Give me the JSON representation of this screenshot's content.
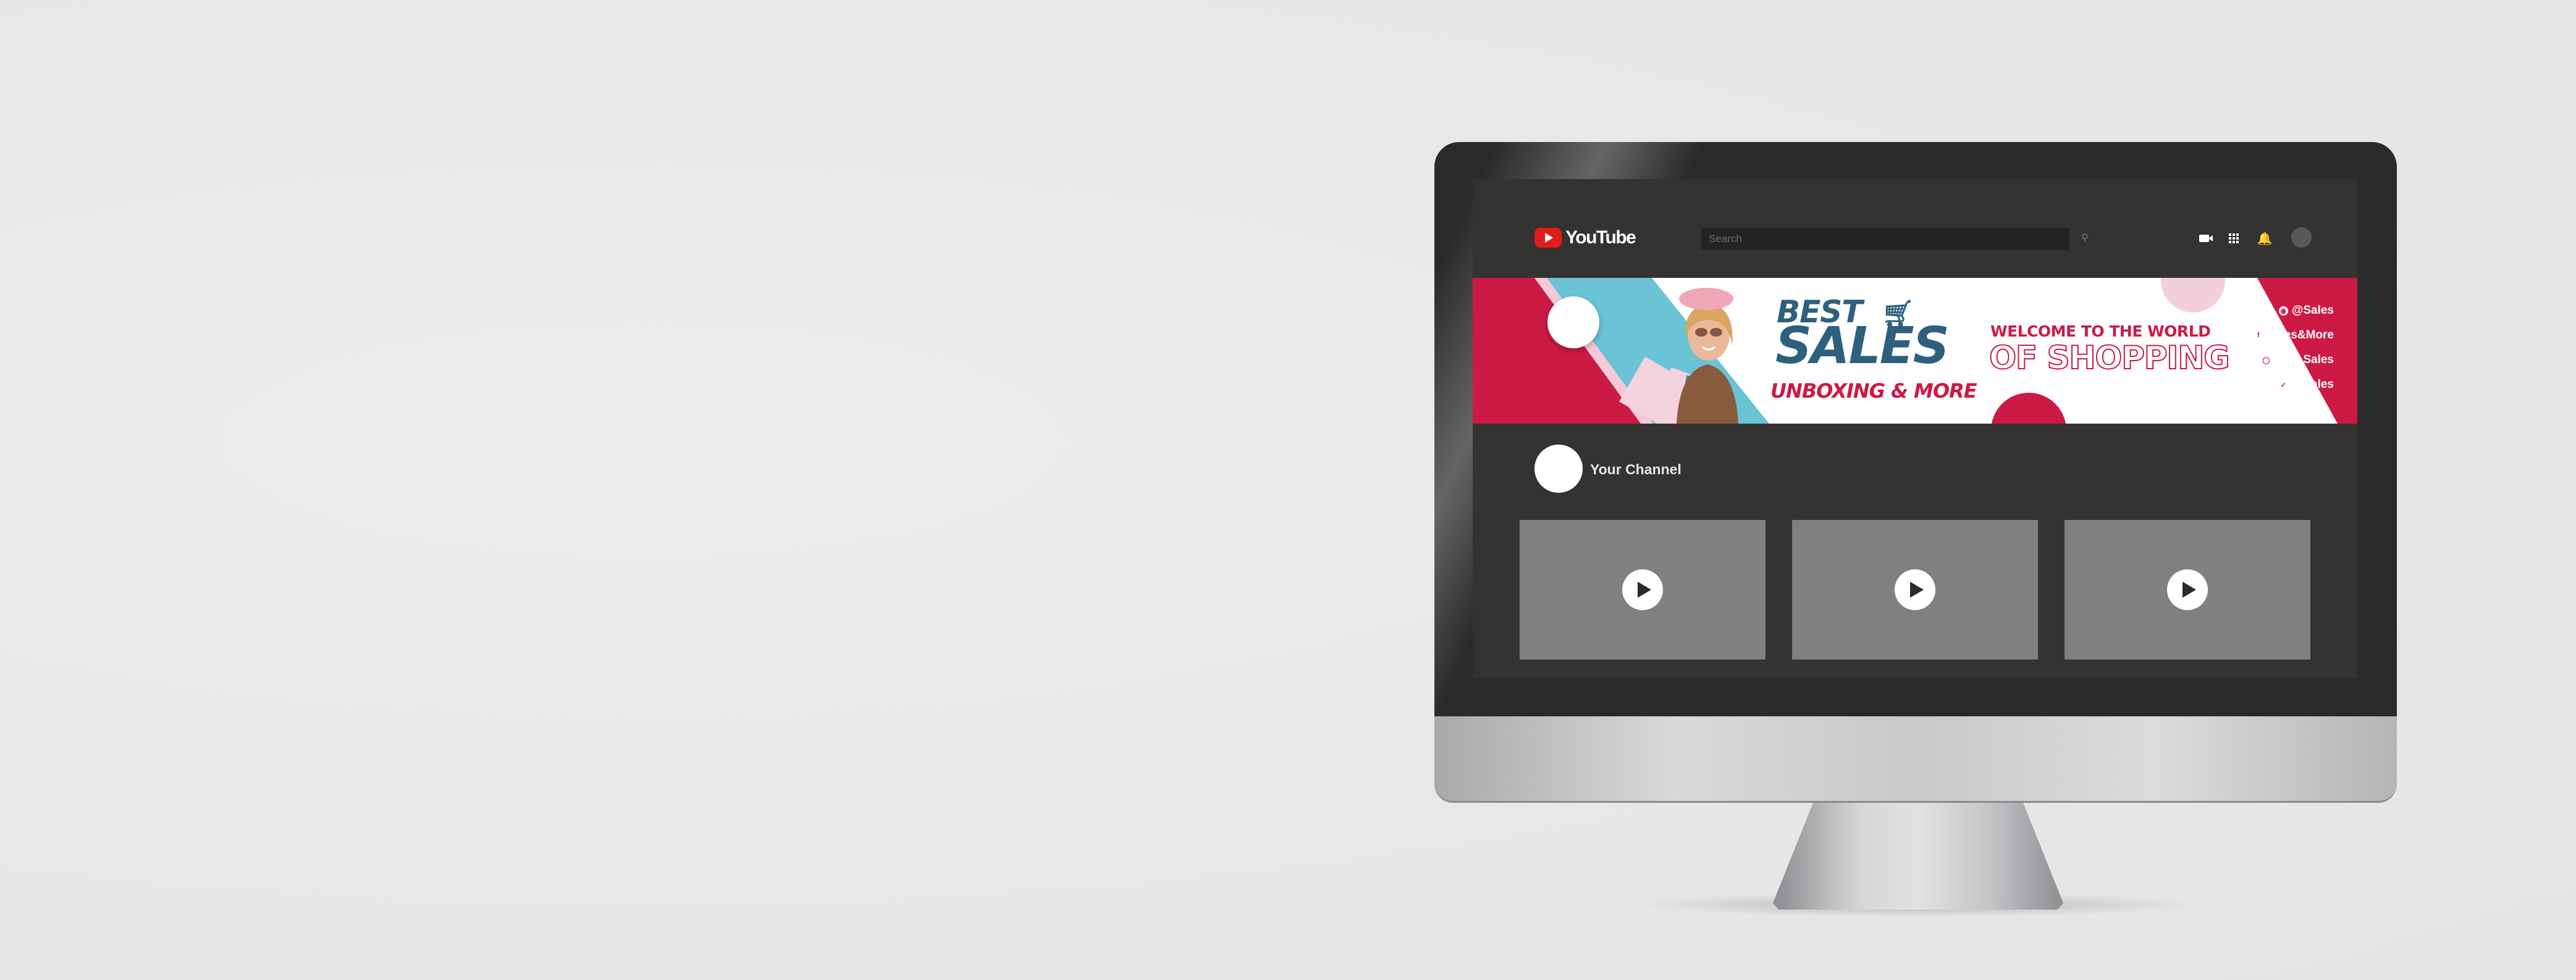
{
  "youtube": {
    "logo_text": "YouTube",
    "search_placeholder": "Search"
  },
  "top_icons": [
    "video-camera-icon",
    "apps-grid-icon",
    "bell-icon",
    "account-avatar"
  ],
  "banner": {
    "best": "BEST",
    "sales": "SALES",
    "unboxing": "UNBOXING & MORE",
    "welcome": "WELCOME TO THE WORLD",
    "shopping": "OF SHOPPING",
    "socials": [
      {
        "icon": "instagram-icon",
        "label": "@Sales"
      },
      {
        "icon": "facebook-icon",
        "label": "Sales&More"
      },
      {
        "icon": "web-icon",
        "label": "Best Sales"
      },
      {
        "icon": "twitter-icon",
        "label": "@Sales"
      }
    ],
    "colors": {
      "red": "#cc1a45",
      "blue": "#2e5f7f",
      "cyan": "#6bc3d6",
      "pink": "#f3cfdb"
    }
  },
  "channel": {
    "name": "Your Channel"
  },
  "videos": [
    {
      "icon": "play-icon"
    },
    {
      "icon": "play-icon"
    },
    {
      "icon": "play-icon"
    }
  ]
}
